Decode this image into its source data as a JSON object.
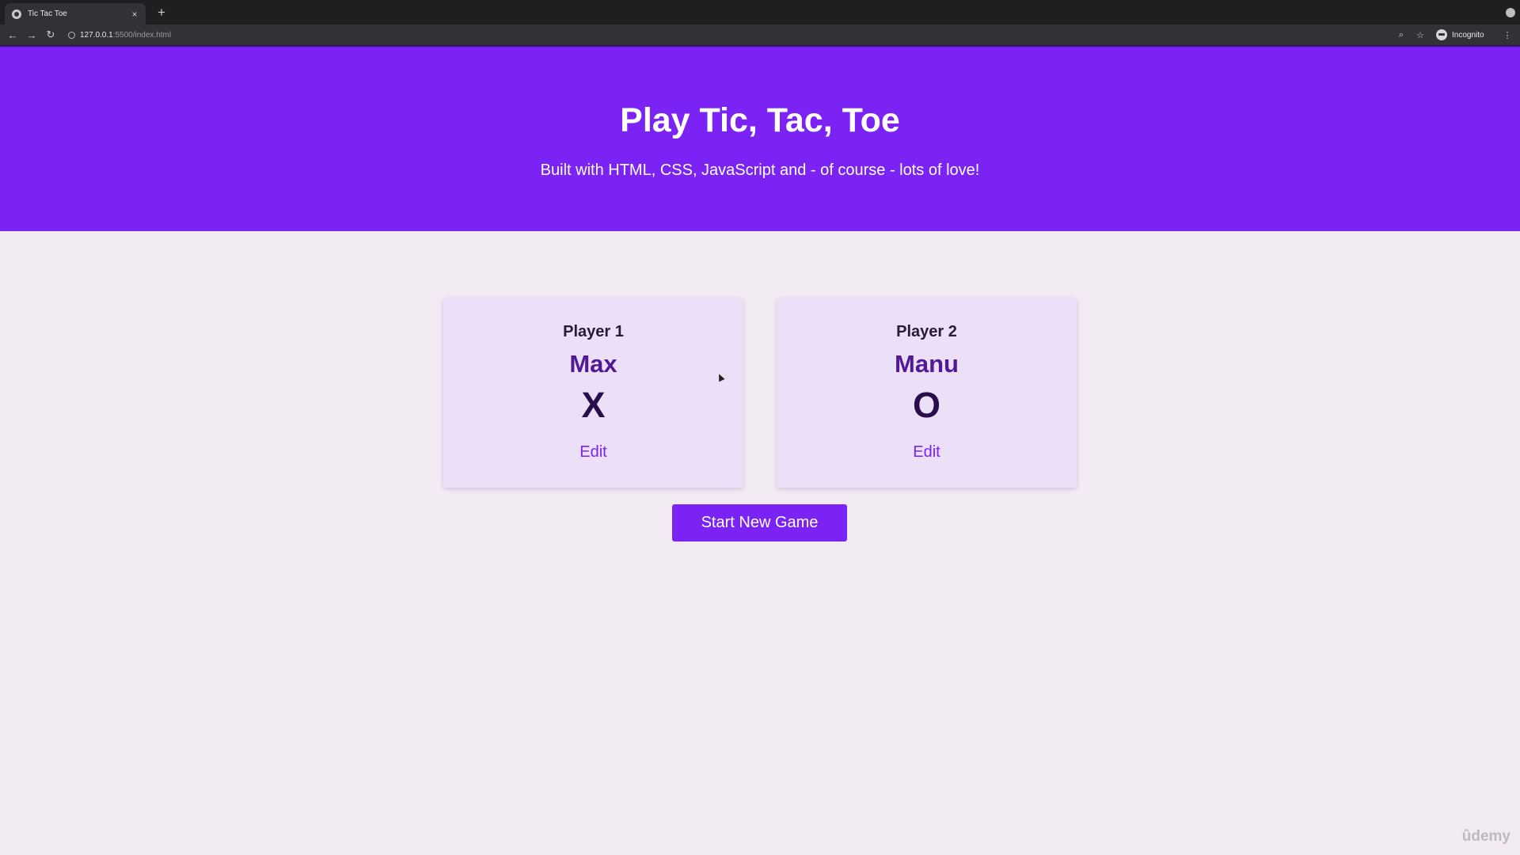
{
  "browser": {
    "tab_title": "Tic Tac Toe",
    "tab_close": "×",
    "new_tab": "+",
    "url_host": "127.0.0.1",
    "url_path": ":5500/index.html",
    "profile_label": "Incognito",
    "icons": {
      "back": "←",
      "forward": "→",
      "reload": "↻",
      "zoom": "⌕",
      "bookmark": "☆",
      "menu": "⋮"
    }
  },
  "header": {
    "title": "Play Tic, Tac, Toe",
    "subtitle": "Built with HTML, CSS, JavaScript and - of course - lots of love!"
  },
  "players": [
    {
      "label": "Player 1",
      "name": "Max",
      "symbol": "X",
      "edit_label": "Edit"
    },
    {
      "label": "Player 2",
      "name": "Manu",
      "symbol": "O",
      "edit_label": "Edit"
    }
  ],
  "start_button_label": "Start New Game",
  "watermark": "ûdemy",
  "colors": {
    "accent": "#7a23f4",
    "page_background": "#f3ebf4",
    "card_background": "#ecdff8",
    "player_name": "#4f1a93"
  }
}
